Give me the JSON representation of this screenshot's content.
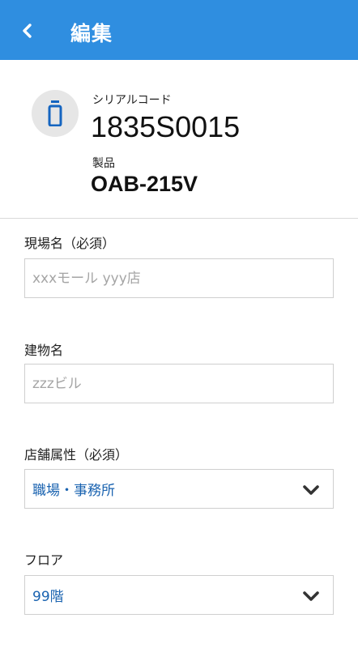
{
  "appbar": {
    "title": "編集",
    "back_icon": "chevron-left-icon",
    "background": "#2f8ee0"
  },
  "device": {
    "icon": "device-icon",
    "serial_label": "シリアルコード",
    "serial_value": "1835S0015",
    "product_label": "製品",
    "product_value": "OAB-215V"
  },
  "form": {
    "site_name": {
      "label": "現場名（必須）",
      "placeholder": "xxxモール yyy店",
      "value": ""
    },
    "building_name": {
      "label": "建物名",
      "placeholder": "zzzビル",
      "value": ""
    },
    "store_attribute": {
      "label": "店舗属性（必須）",
      "selected": "職場・事務所",
      "icon": "chevron-down-icon"
    },
    "floor": {
      "label": "フロア",
      "selected": "99階",
      "icon": "chevron-down-icon"
    }
  },
  "colors": {
    "accent": "#2f8ee0",
    "select_text": "#1a63b0",
    "device_icon": "#1565c0"
  }
}
